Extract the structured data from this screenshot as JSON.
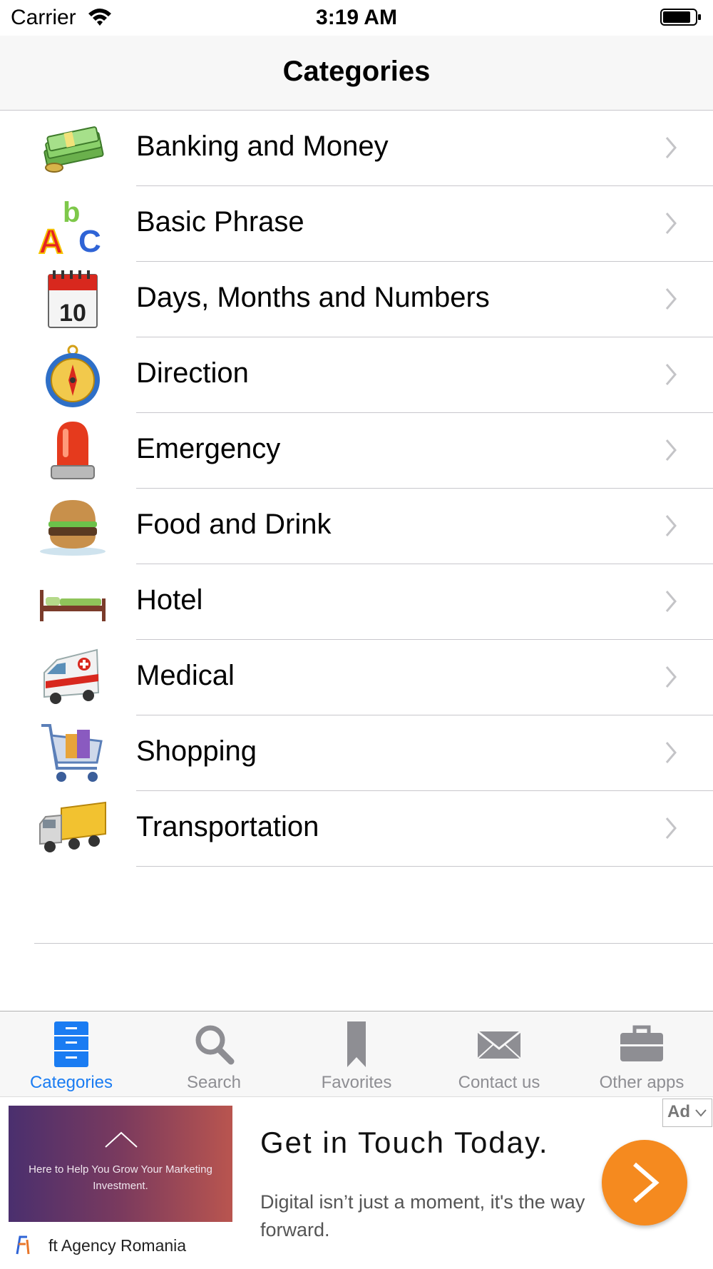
{
  "status_bar": {
    "carrier": "Carrier",
    "time": "3:19 AM"
  },
  "nav": {
    "title": "Categories"
  },
  "categories": [
    {
      "label": "Banking and Money",
      "icon": "money-icon"
    },
    {
      "label": "Basic Phrase",
      "icon": "abc-letters-icon"
    },
    {
      "label": "Days, Months and Numbers",
      "icon": "calendar-icon"
    },
    {
      "label": "Direction",
      "icon": "compass-icon"
    },
    {
      "label": "Emergency",
      "icon": "siren-icon"
    },
    {
      "label": "Food and Drink",
      "icon": "burger-icon"
    },
    {
      "label": "Hotel",
      "icon": "bed-icon"
    },
    {
      "label": "Medical",
      "icon": "ambulance-icon"
    },
    {
      "label": "Shopping",
      "icon": "shopping-cart-icon"
    },
    {
      "label": "Transportation",
      "icon": "truck-icon"
    }
  ],
  "tabs": [
    {
      "label": "Categories",
      "icon": "file-cabinet-icon",
      "active": true
    },
    {
      "label": "Search",
      "icon": "search-icon",
      "active": false
    },
    {
      "label": "Favorites",
      "icon": "bookmark-icon",
      "active": false
    },
    {
      "label": "Contact us",
      "icon": "envelope-icon",
      "active": false
    },
    {
      "label": "Other apps",
      "icon": "briefcase-icon",
      "active": false
    }
  ],
  "ad": {
    "badge": "Ad",
    "image_text": "Here to Help You Grow Your Marketing Investment.",
    "headline": "Get in Touch Today.",
    "body": "Digital isn’t just a moment, it's the way forward.",
    "advertiser": "ft Agency Romania"
  },
  "colors": {
    "accent": "#1a7cf2",
    "cta": "#f58a1f",
    "inactive": "#8e8e93",
    "separator": "#c8c7cc"
  }
}
